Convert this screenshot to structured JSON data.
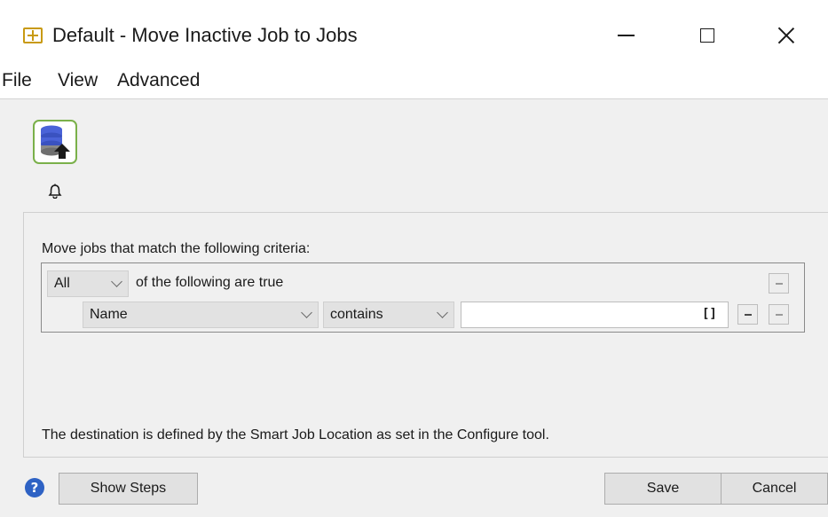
{
  "window": {
    "title": "Default - Move Inactive Job to Jobs",
    "app_icon": "switch-flow-icon",
    "controls": [
      "minimize-icon",
      "maximize-icon",
      "close-icon"
    ]
  },
  "menubar": {
    "items": [
      "File",
      "View",
      "Advanced"
    ]
  },
  "element": {
    "icon": "database-upload-icon",
    "notification_icon": "bell-icon"
  },
  "criteria": {
    "heading": "Move jobs that match the following criteria:",
    "match_mode": "All",
    "match_suffix": "of the following are true",
    "rows": [
      {
        "field": "Name",
        "operator": "contains",
        "value": "",
        "value_icon": "[]"
      }
    ]
  },
  "destination_note": "The destination is defined by the Smart Job Location as set in the Configure tool.",
  "footer": {
    "help_icon": "?",
    "show_steps_label": "Show Steps",
    "save_label": "Save",
    "cancel_label": "Cancel"
  },
  "colors": {
    "accent_green": "#7ab04a",
    "help_blue": "#2e62c4",
    "db_blue": "#4a63d8"
  }
}
